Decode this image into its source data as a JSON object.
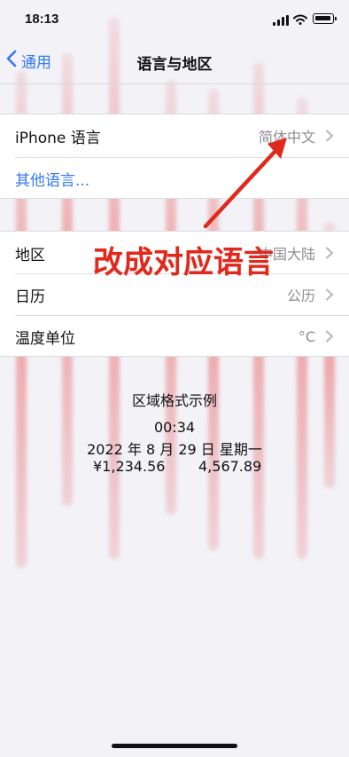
{
  "status": {
    "time": "18:13"
  },
  "nav": {
    "back_label": "通用",
    "title": "语言与地区"
  },
  "group1": {
    "iphone_language_label": "iPhone 语言",
    "iphone_language_value": "简体中文",
    "other_languages_label": "其他语言..."
  },
  "group2": {
    "region_label": "地区",
    "region_value": "中国大陆",
    "calendar_label": "日历",
    "calendar_value": "公历",
    "temperature_label": "温度单位",
    "temperature_value": "°C"
  },
  "example": {
    "title": "区域格式示例",
    "time": "00:34",
    "date": "2022 年 8 月 29 日 星期一",
    "currency": "¥1,234.56",
    "number": "4,567.89"
  },
  "annotation": {
    "text": "改成对应语言",
    "color": "#e1281c"
  },
  "colors": {
    "accent": "#3478f6",
    "watermark": "#e84848"
  },
  "icons": {
    "back": "chevron-left-icon",
    "chevron": "chevron-right-icon",
    "signal": "cellular-signal-icon",
    "wifi": "wifi-icon",
    "battery": "battery-icon"
  }
}
